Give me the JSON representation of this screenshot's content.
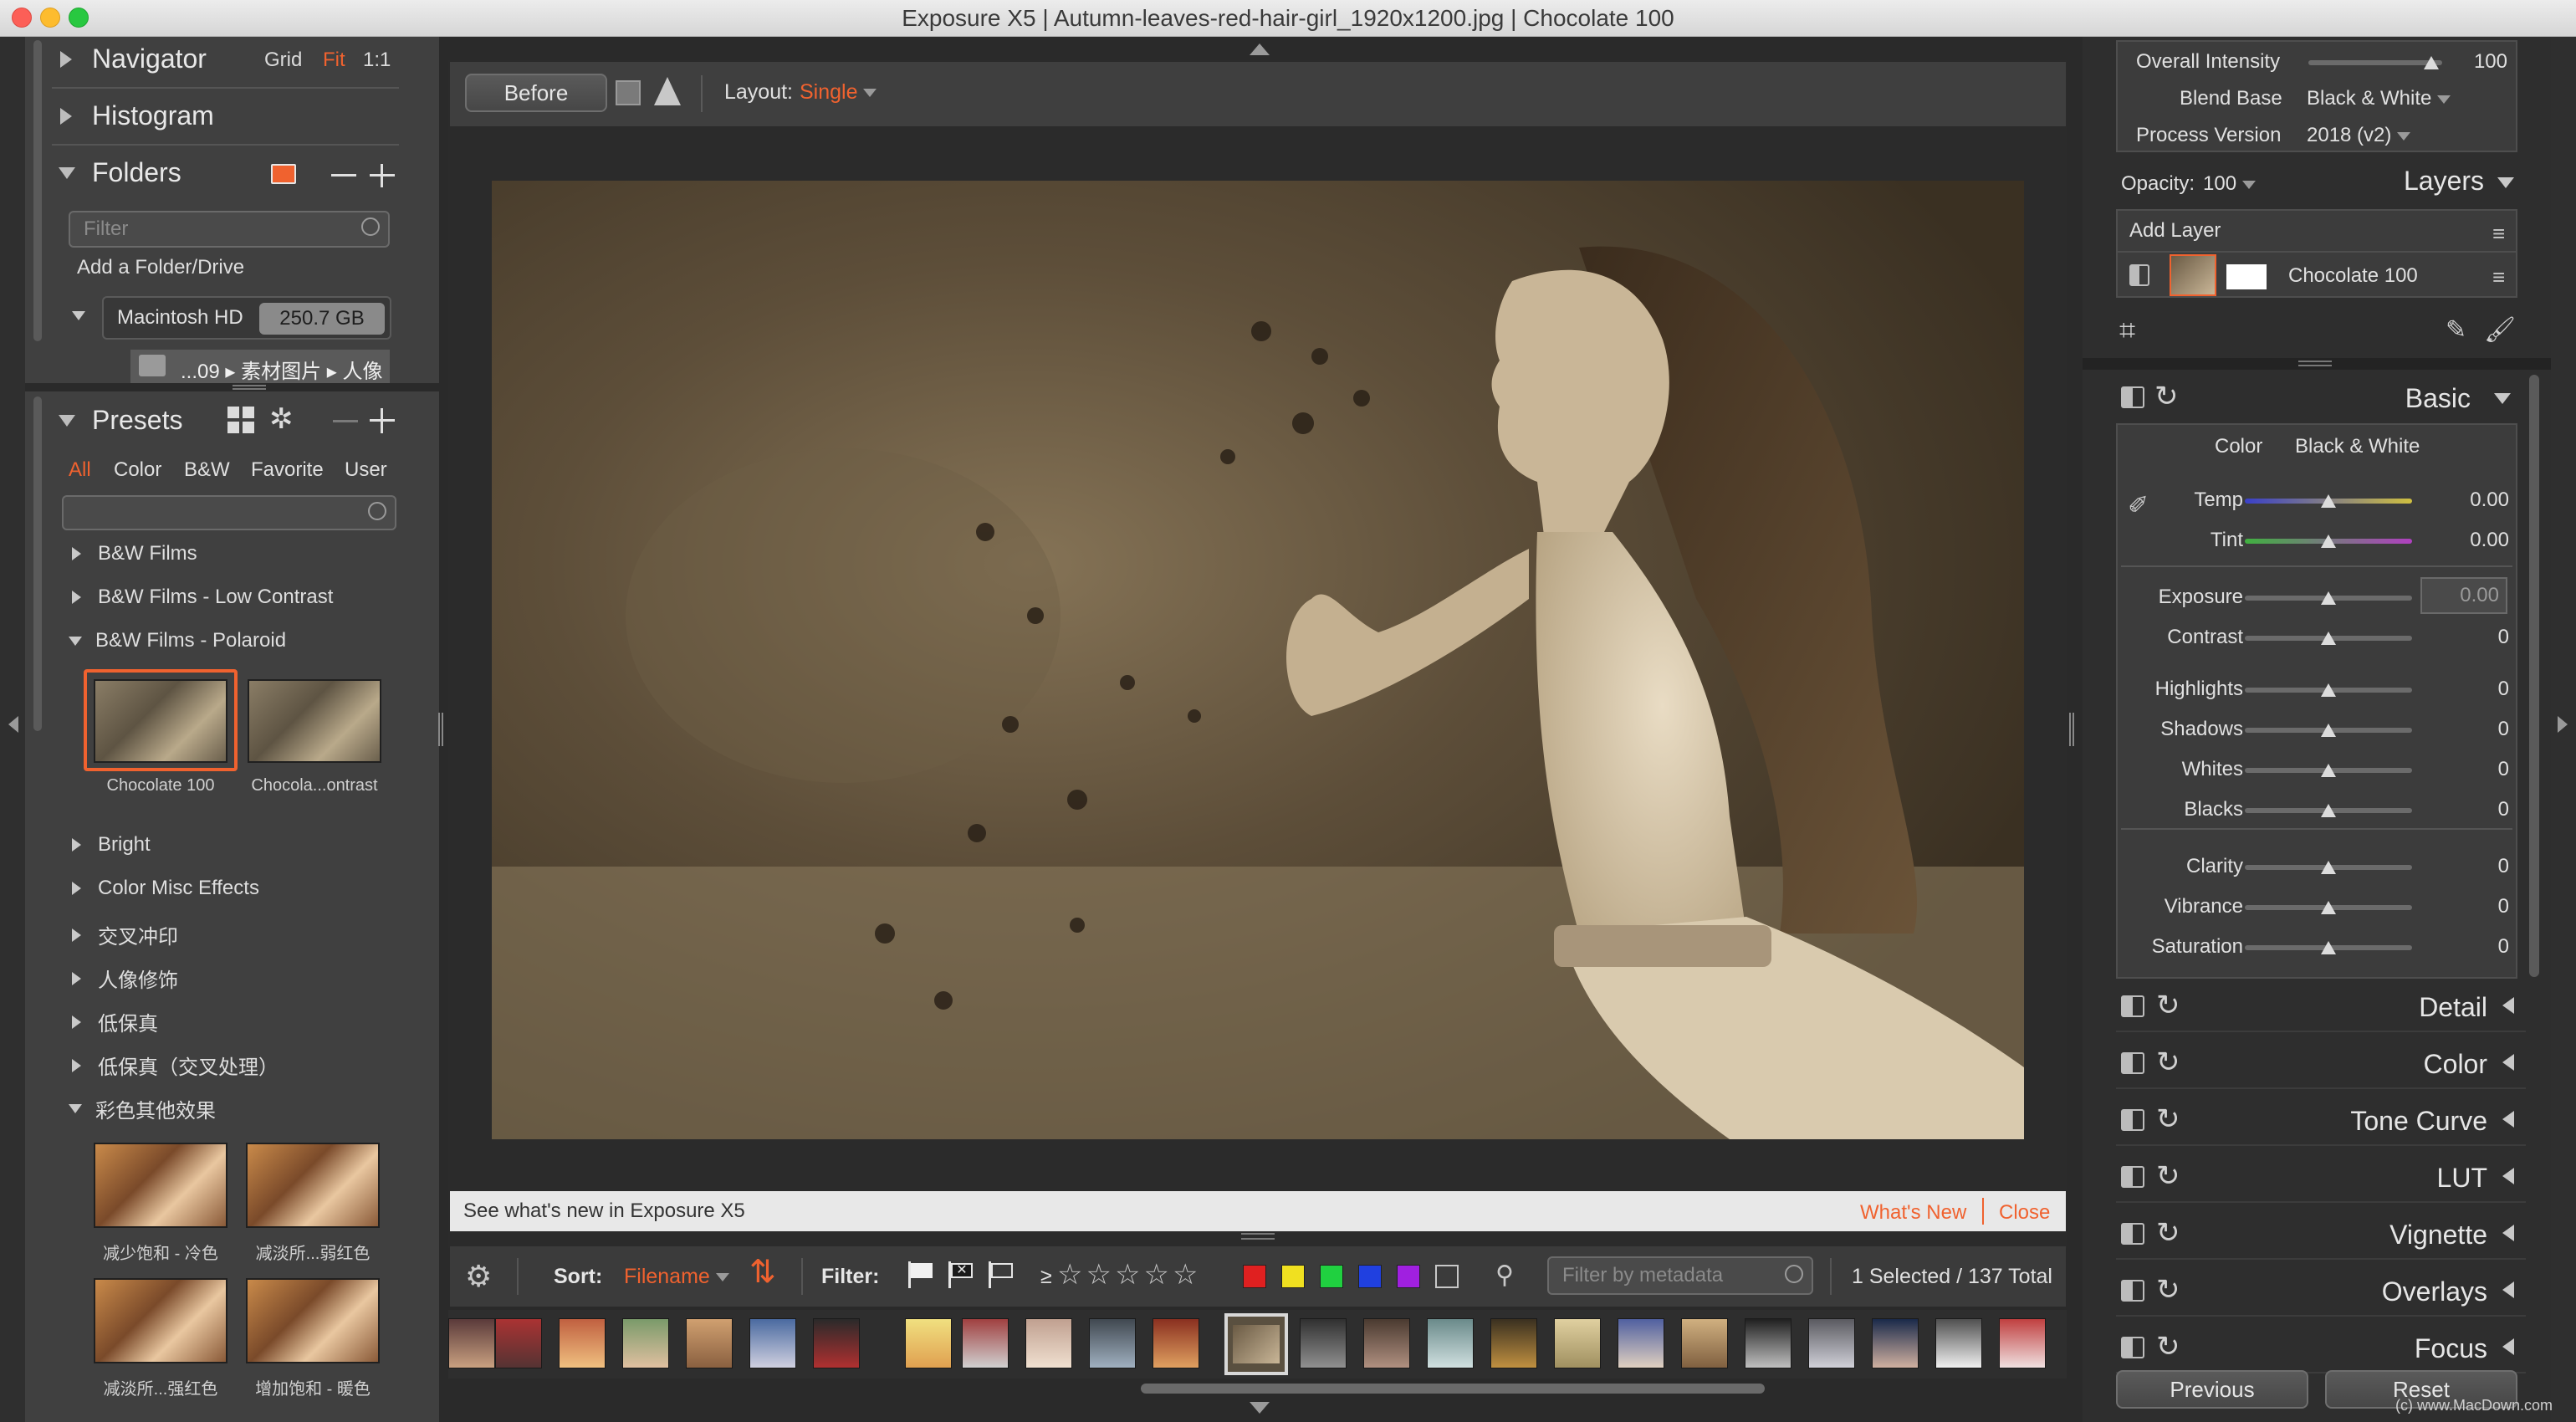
{
  "window": {
    "title": "Exposure X5 | Autumn-leaves-red-hair-girl_1920x1200.jpg | Chocolate 100"
  },
  "left": {
    "navigator": {
      "label": "Navigator",
      "grid": "Grid",
      "fit": "Fit",
      "one": "1:1"
    },
    "histogram": {
      "label": "Histogram"
    },
    "folders": {
      "label": "Folders",
      "filter_placeholder": "Filter",
      "add": "Add a Folder/Drive",
      "drive": "Macintosh HD",
      "drive_size": "250.7 GB",
      "path": "...09 ▸ 素材图片 ▸ 人像"
    },
    "presets": {
      "label": "Presets",
      "tabs": [
        "All",
        "Color",
        "B&W",
        "Favorite",
        "User"
      ],
      "groups": [
        "B&W Films",
        "B&W Films - Low Contrast",
        "B&W Films - Polaroid"
      ],
      "polaroid_thumbs": [
        "Chocolate 100",
        "Chocola...ontrast"
      ],
      "more_groups": [
        "Bright",
        "Color Misc Effects",
        "交叉冲印",
        "人像修饰",
        "低保真",
        "低保真（交叉处理）",
        "彩色其他效果"
      ],
      "color_thumbs": [
        "减少饱和 - 冷色",
        "减淡所...弱红色",
        "减淡所...强红色",
        "增加饱和 - 暖色"
      ]
    }
  },
  "center": {
    "before": "Before",
    "layout_label": "Layout:",
    "layout_value": "Single",
    "banner": {
      "text": "See what's new in Exposure X5",
      "whats_new": "What's New",
      "close": "Close"
    },
    "bottom": {
      "sort_label": "Sort:",
      "sort_value": "Filename",
      "filter_label": "Filter:",
      "ge": "≥",
      "meta_placeholder": "Filter by metadata",
      "selected": "1 Selected / 137 Total"
    },
    "swatch_colors": [
      "#e02020",
      "#f0e020",
      "#20d040",
      "#2040e0",
      "#a020e0"
    ]
  },
  "right": {
    "overall_intensity": {
      "label": "Overall Intensity",
      "value": "100",
      "level": 0.92
    },
    "blend_base": {
      "label": "Blend Base",
      "value": "Black & White"
    },
    "process_version": {
      "label": "Process Version",
      "value": "2018 (v2)"
    },
    "opacity": {
      "label": "Opacity:",
      "value": "100"
    },
    "layers_title": "Layers",
    "add_layer": "Add Layer",
    "layer_name": "Chocolate 100",
    "basic": {
      "title": "Basic",
      "color_label": "Color",
      "color_value": "Black & White",
      "sliders": [
        {
          "label": "Temp",
          "value": "0.00"
        },
        {
          "label": "Tint",
          "value": "0.00"
        },
        {
          "label": "Exposure",
          "value": "0.00"
        },
        {
          "label": "Contrast",
          "value": "0"
        },
        {
          "label": "Highlights",
          "value": "0"
        },
        {
          "label": "Shadows",
          "value": "0"
        },
        {
          "label": "Whites",
          "value": "0"
        },
        {
          "label": "Blacks",
          "value": "0"
        },
        {
          "label": "Clarity",
          "value": "0"
        },
        {
          "label": "Vibrance",
          "value": "0"
        },
        {
          "label": "Saturation",
          "value": "0"
        }
      ]
    },
    "panels": [
      "Detail",
      "Color",
      "Tone Curve",
      "LUT",
      "Vignette",
      "Overlays",
      "Focus"
    ],
    "previous": "Previous",
    "reset": "Reset"
  },
  "watermark": "(c) www.MacDown.com"
}
